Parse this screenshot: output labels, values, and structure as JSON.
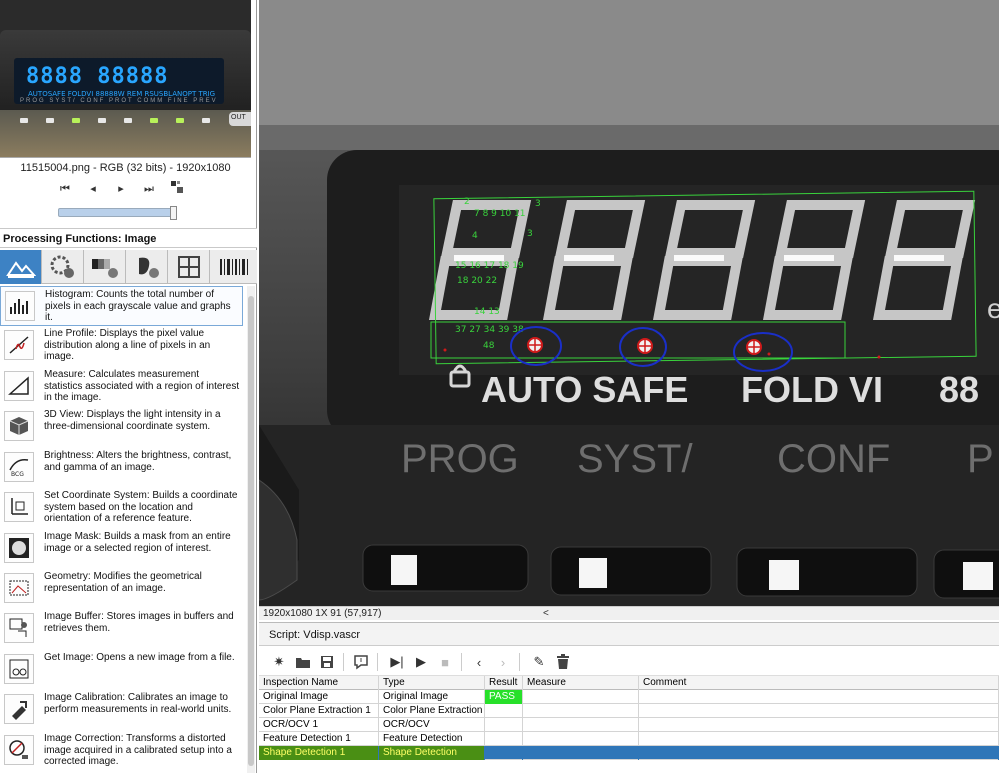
{
  "image_info": "11515004.png - RGB (32 bits) - 1920x1080",
  "thumbnail": {
    "digits": "8888 88888",
    "small": "AUTOSAFE  FOLDVI   88888W REM RSUSBLANOPT TRIG",
    "labels": "PROG SYST/ CONF PROT COMM FINE PREV",
    "out": "OUT"
  },
  "nav_icons": [
    "first-frame-icon",
    "prev-frame-icon",
    "play-icon",
    "last-frame-icon",
    "frame-grid-icon"
  ],
  "processing": {
    "header": "Processing Functions: Image",
    "tabs": [
      "image-tab",
      "color-tab",
      "grayscale-tab",
      "binary-tab",
      "machine-vision-tab",
      "identification-tab"
    ],
    "functions": [
      {
        "icon": "histogram-icon",
        "text": "Histogram:  Counts the total number of pixels in each grayscale value and graphs it."
      },
      {
        "icon": "line-profile-icon",
        "text": "Line Profile:  Displays the pixel value distribution along a line of pixels in an image."
      },
      {
        "icon": "measure-icon",
        "text": "Measure:  Calculates measurement statistics associated with a region of interest in the image."
      },
      {
        "icon": "3d-view-icon",
        "text": "3D View:  Displays the light intensity in a three-dimensional coordinate system."
      },
      {
        "icon": "brightness-icon",
        "text": "Brightness:  Alters the brightness, contrast, and gamma of an image."
      },
      {
        "icon": "coordinate-system-icon",
        "text": "Set Coordinate System:  Builds a coordinate system based on the location and orientation of a reference feature."
      },
      {
        "icon": "image-mask-icon",
        "text": "Image Mask:  Builds a mask from an entire image or a selected region of interest."
      },
      {
        "icon": "geometry-icon",
        "text": "Geometry:  Modifies the geometrical representation of an image."
      },
      {
        "icon": "image-buffer-icon",
        "text": "Image Buffer:  Stores images in buffers and retrieves them."
      },
      {
        "icon": "get-image-icon",
        "text": "Get Image:  Opens a new image from a file."
      },
      {
        "icon": "image-calibration-icon",
        "text": "Image Calibration:  Calibrates an image to perform measurements in real-world units."
      },
      {
        "icon": "image-correction-icon",
        "text": "Image Correction:  Transforms a distorted image acquired in a calibrated setup into a corrected image."
      }
    ]
  },
  "main_image": {
    "front_labels": [
      "AUTO SAFE",
      "FOLD VI",
      "88"
    ],
    "panel_labels": [
      "PROG",
      "SYST/",
      "CONF",
      "P"
    ],
    "small_letter": "e"
  },
  "status": {
    "text": "1920x1080 1X 91    (57,917)",
    "arrow": "<"
  },
  "script": {
    "title": "Script: Vdisp.vascr",
    "columns": [
      "Inspection Name",
      "Type",
      "Result",
      "Measure",
      "Comment"
    ],
    "rows": [
      {
        "name": "Original Image",
        "type": "Original Image",
        "result": "PASS",
        "measure": "",
        "comment": ""
      },
      {
        "name": "Color Plane Extraction 1",
        "type": "Color Plane Extraction",
        "result": "",
        "measure": "",
        "comment": ""
      },
      {
        "name": "OCR/OCV 1",
        "type": "OCR/OCV",
        "result": "",
        "measure": "",
        "comment": ""
      },
      {
        "name": "Feature Detection 1",
        "type": "Feature Detection",
        "result": "",
        "measure": "",
        "comment": ""
      },
      {
        "name": "Shape Detection 1",
        "type": "Shape Detection",
        "result": "",
        "measure": "",
        "comment": ""
      }
    ]
  },
  "colors": {
    "pass": "#27e02a",
    "selected_row": "#2f76b8",
    "overlay_green": "#39d23c",
    "circle_blue": "#1a2fc8"
  }
}
